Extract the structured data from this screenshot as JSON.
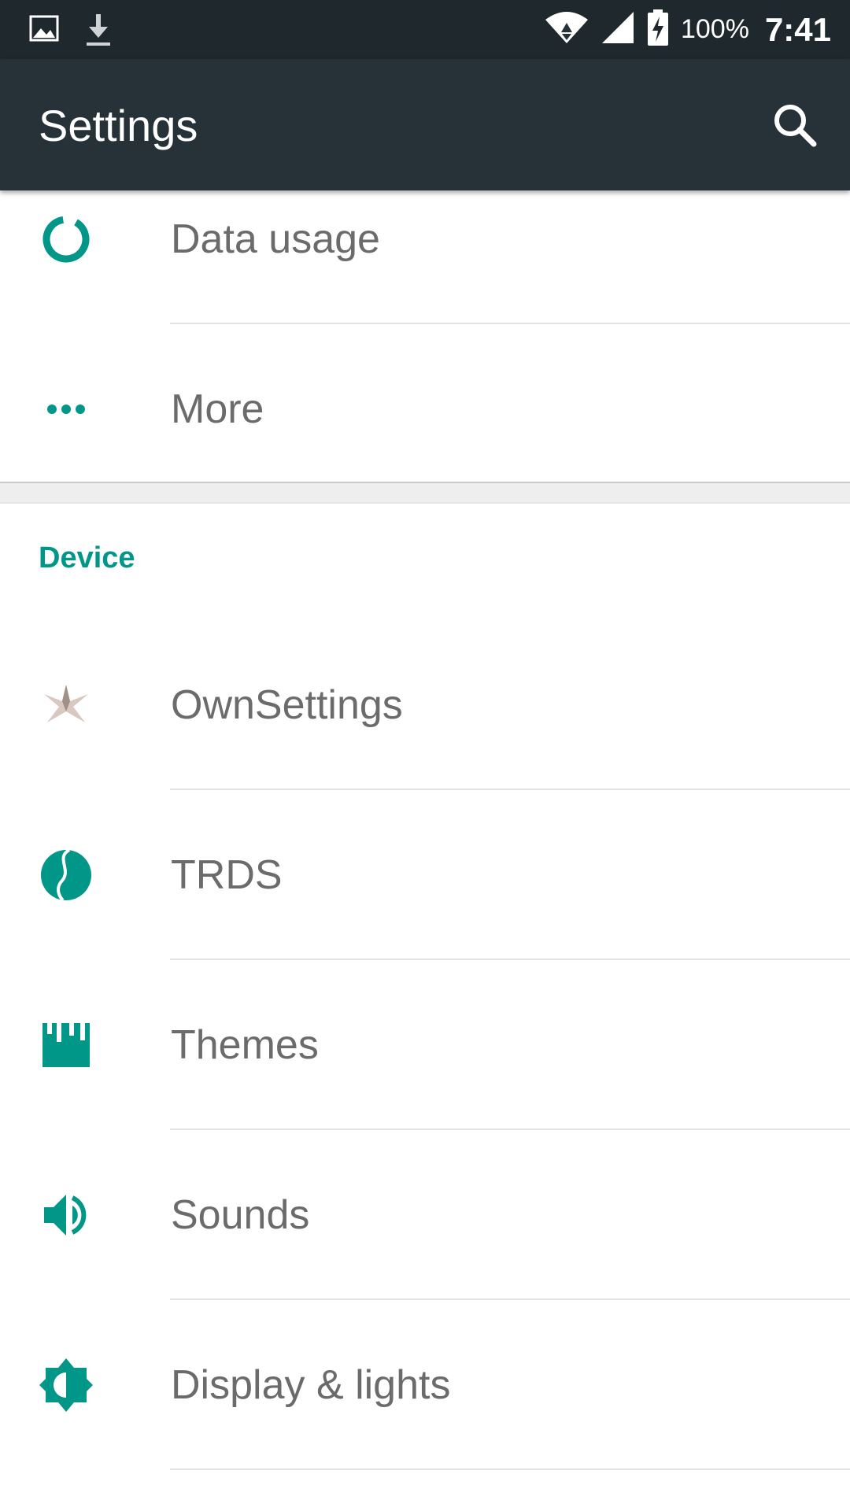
{
  "status_bar": {
    "battery_percent": "100%",
    "time": "7:41",
    "icons": [
      "gallery-icon",
      "download-icon",
      "wifi-icon",
      "signal-icon",
      "battery-charging-icon"
    ]
  },
  "toolbar": {
    "title": "Settings",
    "search_icon": "search-icon"
  },
  "wireless": {
    "items": [
      {
        "label": "Data usage",
        "icon": "data-usage-icon"
      },
      {
        "label": "More",
        "icon": "more-dots-icon"
      }
    ]
  },
  "device": {
    "header": "Device",
    "items": [
      {
        "label": "OwnSettings",
        "icon": "ownsettings-star-icon"
      },
      {
        "label": "TRDS",
        "icon": "trds-icon"
      },
      {
        "label": "Themes",
        "icon": "themes-icon"
      },
      {
        "label": "Sounds",
        "icon": "volume-icon"
      },
      {
        "label": "Display & lights",
        "icon": "brightness-icon"
      }
    ]
  },
  "colors": {
    "accent": "#009688",
    "toolbar": "#263238",
    "status_bar": "#1f282d",
    "label_text": "#6b6b6b"
  }
}
